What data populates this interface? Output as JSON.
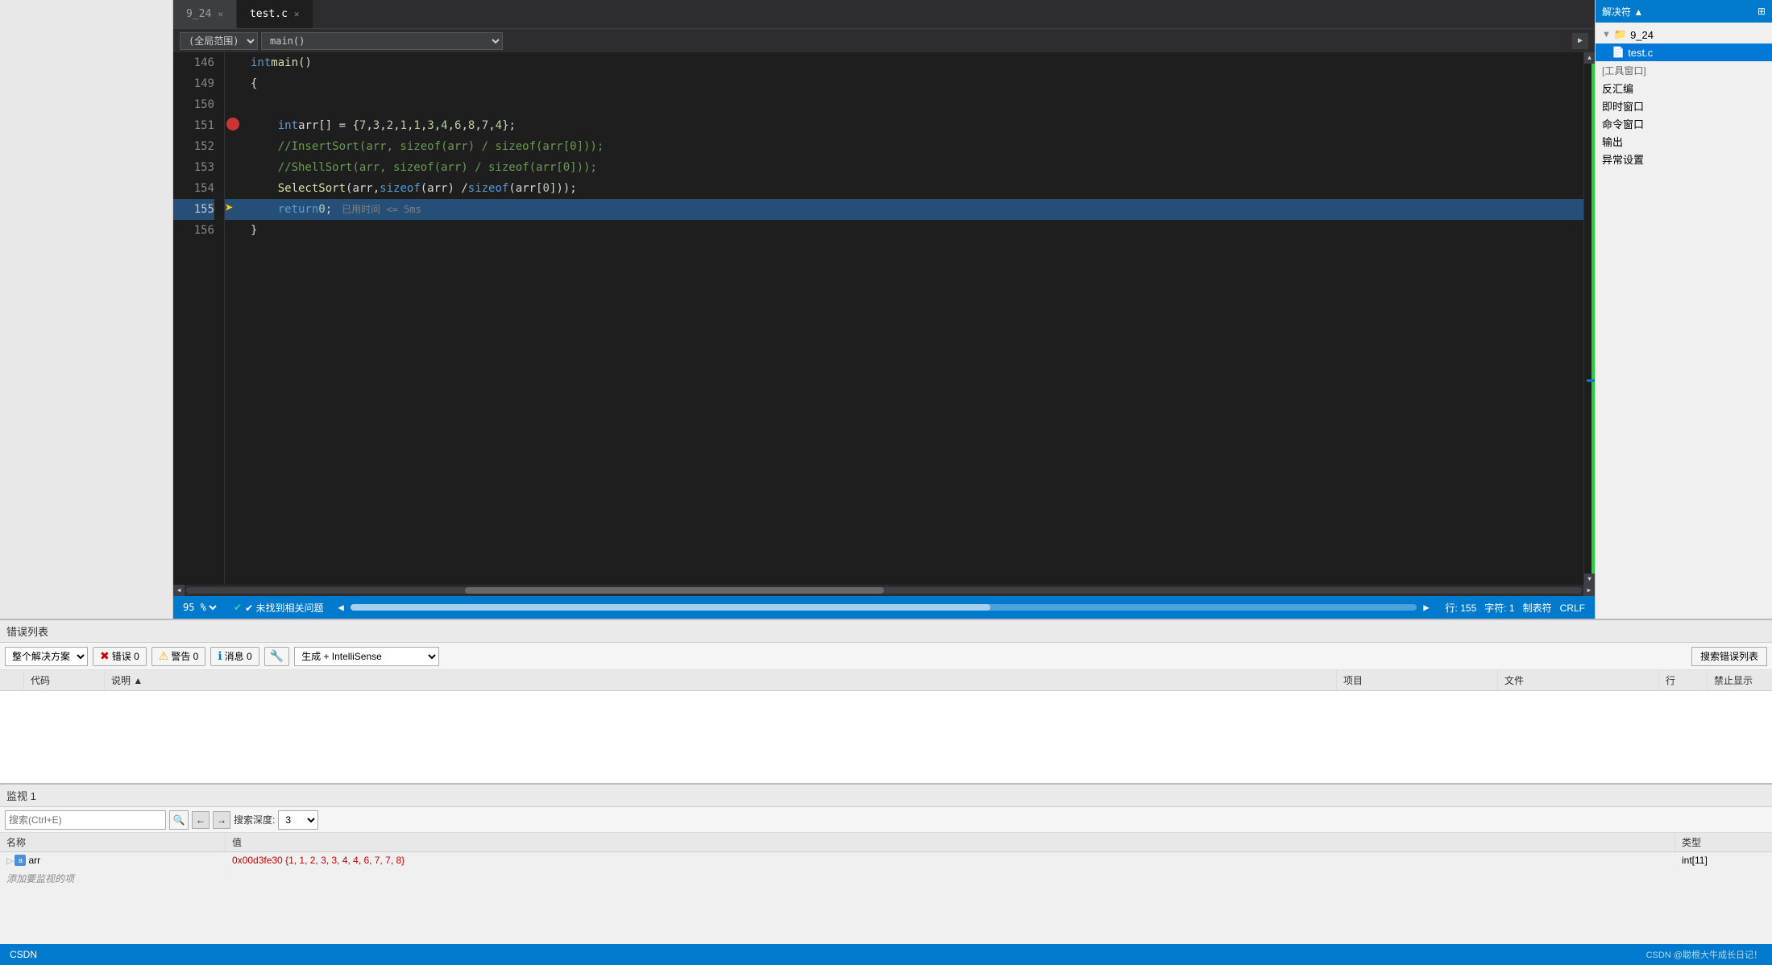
{
  "editor": {
    "tabs": [
      {
        "label": "9_24",
        "active": false
      },
      {
        "label": "test.c",
        "active": true
      }
    ],
    "toolbar": {
      "scope_select": "(全局范围)",
      "func_select": "main()"
    },
    "lines": [
      {
        "num": "146",
        "active": false,
        "content": "int main()",
        "tokens": [
          {
            "t": "keyword",
            "v": "int"
          },
          {
            "t": "plain",
            "v": " "
          },
          {
            "t": "function",
            "v": "main"
          },
          {
            "t": "plain",
            "v": "()"
          }
        ]
      },
      {
        "num": "149",
        "active": false,
        "content": "{",
        "tokens": [
          {
            "t": "plain",
            "v": "{"
          }
        ]
      },
      {
        "num": "150",
        "active": false,
        "content": "",
        "tokens": []
      },
      {
        "num": "151",
        "active": false,
        "content": "    int arr[] = { 7,3,2,1,1,3,4,6,8,7,4 };",
        "tokens": [
          {
            "t": "plain",
            "v": "    "
          },
          {
            "t": "keyword",
            "v": "int"
          },
          {
            "t": "plain",
            "v": " arr[] = { "
          },
          {
            "t": "number",
            "v": "7"
          },
          {
            "t": "plain",
            "v": ","
          },
          {
            "t": "number",
            "v": "3"
          },
          {
            "t": "plain",
            "v": ","
          },
          {
            "t": "number",
            "v": "2"
          },
          {
            "t": "plain",
            "v": ","
          },
          {
            "t": "number",
            "v": "1"
          },
          {
            "t": "plain",
            "v": ","
          },
          {
            "t": "number",
            "v": "1"
          },
          {
            "t": "plain",
            "v": ","
          },
          {
            "t": "number",
            "v": "3"
          },
          {
            "t": "plain",
            "v": ","
          },
          {
            "t": "number",
            "v": "4"
          },
          {
            "t": "plain",
            "v": ","
          },
          {
            "t": "number",
            "v": "6"
          },
          {
            "t": "plain",
            "v": ","
          },
          {
            "t": "number",
            "v": "8"
          },
          {
            "t": "plain",
            "v": ","
          },
          {
            "t": "number",
            "v": "7"
          },
          {
            "t": "plain",
            "v": ","
          },
          {
            "t": "number",
            "v": "4"
          },
          {
            "t": "plain",
            "v": " };"
          }
        ]
      },
      {
        "num": "152",
        "active": false,
        "content": "    //InsertSort(arr, sizeof(arr) / sizeof(arr[0]));",
        "comment": true
      },
      {
        "num": "153",
        "active": false,
        "content": "    //ShellSort(arr, sizeof(arr) / sizeof(arr[0]));",
        "comment": true
      },
      {
        "num": "154",
        "active": false,
        "content": "    SelectSort(arr, sizeof(arr) / sizeof(arr[0]));",
        "tokens": [
          {
            "t": "plain",
            "v": "    "
          },
          {
            "t": "function",
            "v": "SelectSort"
          },
          {
            "t": "plain",
            "v": "(arr, "
          },
          {
            "t": "keyword",
            "v": "sizeof"
          },
          {
            "t": "plain",
            "v": "(arr) / "
          },
          {
            "t": "keyword",
            "v": "sizeof"
          },
          {
            "t": "plain",
            "v": "(arr["
          },
          {
            "t": "number",
            "v": "0"
          },
          {
            "t": "plain",
            "v": "]));"
          }
        ]
      },
      {
        "num": "155",
        "active": true,
        "content": "    return 0;  已用时间 <= 5ms",
        "tokens": [
          {
            "t": "plain",
            "v": "    "
          },
          {
            "t": "keyword",
            "v": "return"
          },
          {
            "t": "plain",
            "v": " "
          },
          {
            "t": "number",
            "v": "0"
          },
          {
            "t": "plain",
            "v": ";"
          }
        ],
        "timing": "已用时间 <= 5ms"
      },
      {
        "num": "156",
        "active": false,
        "content": "}",
        "tokens": [
          {
            "t": "plain",
            "v": "}"
          }
        ]
      }
    ]
  },
  "statusbar": {
    "no_issues": "✔ 未找到相关问题",
    "line_info": "行: 155",
    "char_info": "字符: 1",
    "tab_label": "制表符",
    "crlf": "CRLF",
    "zoom": "95 %"
  },
  "errorlist": {
    "title": "错误列表",
    "scope_options": [
      "整个解决方案"
    ],
    "scope_selected": "整个解决方案",
    "error_btn": "错误 0",
    "warn_btn": "警告 0",
    "info_btn": "消息 0",
    "build_btn": "生成 + IntelliSense",
    "search_btn": "搜索错误列表",
    "filter_icon_title": "筛选器",
    "columns": [
      "",
      "代码",
      "说明",
      "项目",
      "文件",
      "行",
      "禁止显示"
    ],
    "rows": []
  },
  "watch": {
    "title": "监视 1",
    "search_placeholder": "搜索(Ctrl+E)",
    "search_icon": "🔍",
    "depth_label": "搜索深度:",
    "depth_value": "3",
    "columns": [
      "名称",
      "值",
      "类型"
    ],
    "rows": [
      {
        "name": "arr",
        "value": "0x00d3fe30 {1, 1, 2, 3, 3, 4, 4, 6, 7, 7, 8}",
        "type": "int[11]",
        "expandable": true
      }
    ],
    "add_hint": "添加要监视的项"
  },
  "right_panel": {
    "header": "解决符 ▲",
    "items": [
      {
        "label": "9_24",
        "level": 0,
        "icon": "📁"
      },
      {
        "label": "test.c",
        "level": 1,
        "selected": true,
        "icon": "📄"
      },
      {
        "label": "[工具窗口]",
        "level": 0,
        "section": true
      },
      {
        "label": "反汇编",
        "level": 0
      },
      {
        "label": "即时窗口",
        "level": 0
      },
      {
        "label": "命令窗口",
        "level": 0
      },
      {
        "label": "输出",
        "level": 0
      },
      {
        "label": "异常设置",
        "level": 0
      }
    ]
  }
}
